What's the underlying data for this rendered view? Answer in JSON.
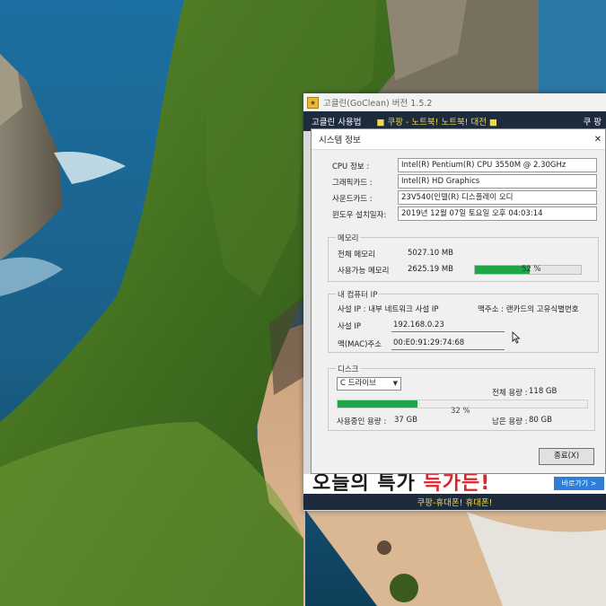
{
  "app": {
    "title": "고클린(GoClean) 버전 1.5.2",
    "menu": {
      "left": "고클린 사용법",
      "banner": "■ 쿠팡 - 노트북! 노트북! 대전 ■",
      "right": "쿠 팡"
    },
    "ad": {
      "headline_start": "오늘의 ",
      "headline_mid": "특가 ",
      "headline_end": "득가든!",
      "link": "바로가기 >"
    },
    "bottom_banner": "쿠팡-휴대폰! 휴대폰!"
  },
  "dialog": {
    "title": "시스템 정보",
    "close": "✕",
    "cpu": {
      "label": "CPU 정보 :",
      "value": "Intel(R) Pentium(R) CPU 3550M @ 2.30GHz"
    },
    "graphics": {
      "label": "그래픽카드 :",
      "value": "Intel(R) HD Graphics"
    },
    "sound": {
      "label": "사운드카드 :",
      "value": "23V540(인텔(R) 디스플레이 오디"
    },
    "install": {
      "label": "윈도우 설치일자:",
      "value": "2019년 12월 07일 토요일 오후 04:03:14"
    },
    "memory": {
      "legend": "메모리",
      "total_label": "전체 메모리",
      "total_value": "5027.10 MB",
      "avail_label": "사용가능 메모리",
      "avail_value": "2625.19 MB",
      "avail_percent": 52,
      "avail_percent_text": "52 %"
    },
    "network": {
      "legend": "내 컴퓨터 IP",
      "note_left": "사설 IP : 내부 네트워크 사설 IP",
      "note_right": "맥주소 : 랜카드의 고유식별번호",
      "ip_label": "사설 IP",
      "ip_value": "192.168.0.23",
      "mac_label": "맥(MAC)주소",
      "mac_value": "00:E0:91:29:74:68"
    },
    "disk": {
      "legend": "디스크",
      "drive_option": "C 드라이브",
      "used_percent": 32,
      "used_percent_text": "32 %",
      "total_label": "전체 용량 :",
      "total_value": "118 GB",
      "used_label": "사용중인 용량 :",
      "used_value": "37 GB",
      "free_label": "남은 용량 :",
      "free_value": "80 GB"
    },
    "close_button": "종료(X)"
  },
  "colors": {
    "progress": "#1fa648",
    "menubar": "#1e2b3d",
    "banner_text": "#f0d84a"
  }
}
